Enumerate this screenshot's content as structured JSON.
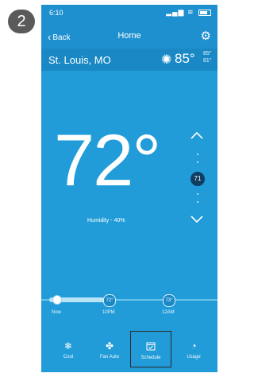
{
  "step": "2",
  "status_bar": {
    "time": "6:10"
  },
  "nav": {
    "back_label": "Back",
    "title": "Home"
  },
  "location": {
    "city": "St. Louis, MO",
    "outside_temp": "85°",
    "high": "85°",
    "low": "81°"
  },
  "thermostat": {
    "setpoint": "72°",
    "humidity": "Humidity - 40%",
    "scale_value": "71"
  },
  "timeline": {
    "items": [
      {
        "badge": "",
        "label": "Now"
      },
      {
        "badge": "72°",
        "label": "10PM"
      },
      {
        "badge": "73°",
        "label": "12AM"
      }
    ]
  },
  "bottom_nav": {
    "items": [
      {
        "label": "Cool",
        "icon": "snowflake-icon"
      },
      {
        "label": "Fan Auto",
        "icon": "fan-icon"
      },
      {
        "label": "Schedule",
        "icon": "calendar-icon",
        "selected": true
      },
      {
        "label": "Usage",
        "icon": "gauge-icon"
      }
    ]
  },
  "colors": {
    "primary": "#219cd8",
    "header": "#1e90cf",
    "location_bar": "#1a88c5",
    "scale_badge": "#0f3e63"
  }
}
